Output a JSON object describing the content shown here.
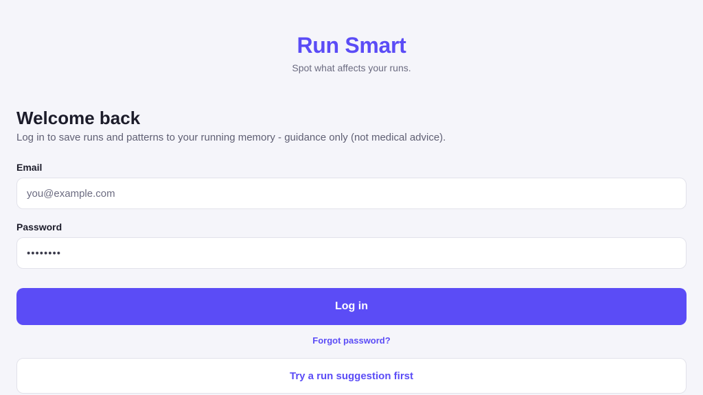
{
  "header": {
    "app_name": "Run Smart",
    "tagline": "Spot what affects your runs."
  },
  "login": {
    "title": "Welcome back",
    "subtitle": "Log in to save runs and patterns to your running memory - guidance only (not medical advice).",
    "email": {
      "label": "Email",
      "placeholder": "you@example.com",
      "value": ""
    },
    "password": {
      "label": "Password",
      "value": "12345678"
    },
    "login_button": "Log in",
    "forgot_link": "Forgot password?",
    "try_button": "Try a run suggestion first"
  },
  "colors": {
    "accent": "#5b4cf6",
    "background": "#f5f5fa"
  }
}
